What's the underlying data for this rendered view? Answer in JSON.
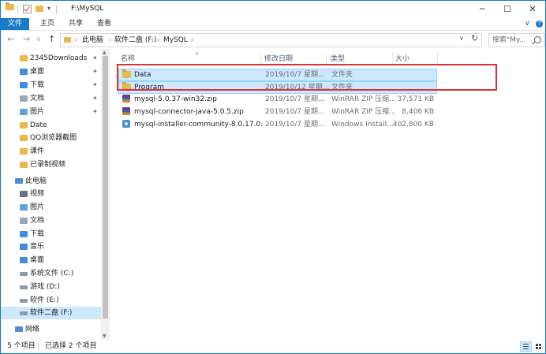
{
  "window": {
    "title": "F:\\MySQL",
    "controls": {
      "minimize": "─",
      "maximize": "☐",
      "close": "✕"
    }
  },
  "ribbon": {
    "tabs": [
      "文件",
      "主页",
      "共享",
      "查看"
    ],
    "expand_icon": "chevron-down-icon",
    "help_icon": "help-icon"
  },
  "nav": {
    "back": "←",
    "forward": "→",
    "recent": "∨",
    "up": "↑",
    "breadcrumb": [
      "此电脑",
      "软件二盘 (F:)",
      "MySQL"
    ],
    "search_placeholder": "搜索\"My...",
    "refresh": "↻",
    "dropdown": "∨"
  },
  "sidebar": {
    "items": [
      {
        "label": "2345Downloads",
        "icon": "folder-icon",
        "pinned": true
      },
      {
        "label": "桌面",
        "icon": "desktop-folder-icon",
        "pinned": true
      },
      {
        "label": "下载",
        "icon": "download-folder-icon",
        "pinned": true
      },
      {
        "label": "文档",
        "icon": "documents-folder-icon",
        "pinned": true
      },
      {
        "label": "图片",
        "icon": "pictures-folder-icon",
        "pinned": true
      },
      {
        "label": "Date",
        "icon": "folder-icon",
        "pinned": false
      },
      {
        "label": "QQ浏览器截图",
        "icon": "folder-icon",
        "pinned": false
      },
      {
        "label": "课件",
        "icon": "folder-icon",
        "pinned": false
      },
      {
        "label": "已录制视频",
        "icon": "folder-icon",
        "pinned": false
      },
      {
        "label": "此电脑",
        "icon": "computer-icon",
        "pinned": false
      },
      {
        "label": "视频",
        "icon": "videos-folder-icon",
        "pinned": false
      },
      {
        "label": "图片",
        "icon": "pictures-folder-icon",
        "pinned": false
      },
      {
        "label": "文档",
        "icon": "documents-folder-icon",
        "pinned": false
      },
      {
        "label": "下载",
        "icon": "download-folder-icon",
        "pinned": false
      },
      {
        "label": "音乐",
        "icon": "music-folder-icon",
        "pinned": false
      },
      {
        "label": "桌面",
        "icon": "desktop-folder-icon",
        "pinned": false
      },
      {
        "label": "系统文件 (C:)",
        "icon": "drive-icon",
        "pinned": false
      },
      {
        "label": "游戏 (D:)",
        "icon": "drive-icon",
        "pinned": false
      },
      {
        "label": "软件 (E:)",
        "icon": "drive-icon",
        "pinned": false
      },
      {
        "label": "软件二盘 (F:)",
        "icon": "drive-icon",
        "pinned": false,
        "selected": true
      },
      {
        "label": "网络",
        "icon": "network-icon",
        "pinned": false
      }
    ]
  },
  "columns": [
    "名称",
    "修改日期",
    "类型",
    "大小"
  ],
  "files": [
    {
      "name": "Data",
      "date": "2019/10/7 星期...",
      "type": "文件夹",
      "size": "",
      "icon": "folder-icon",
      "selected": true
    },
    {
      "name": "Program",
      "date": "2019/10/12 星期...",
      "type": "文件夹",
      "size": "",
      "icon": "folder-icon",
      "selected": true
    },
    {
      "name": "mysql-5.0.37-win32.zip",
      "date": "2019/10/7 星期...",
      "type": "WinRAR ZIP 压缩...",
      "size": "37,571 KB",
      "icon": "winrar-zip-icon",
      "selected": false
    },
    {
      "name": "mysql-connector-java-5.0.5.zip",
      "date": "2019/10/7 星期...",
      "type": "WinRAR ZIP 压缩...",
      "size": "8,406 KB",
      "icon": "winrar-zip-icon",
      "selected": false
    },
    {
      "name": "mysql-installer-community-8.0.17.0....",
      "date": "2019/10/7 星期...",
      "type": "Windows Install...",
      "size": "402,800 KB",
      "icon": "installer-icon",
      "selected": false
    }
  ],
  "status": {
    "item_count": "5 个项目",
    "selected_count": "已选择 2 个项目"
  },
  "colors": {
    "accent": "#1979ca",
    "selection": "#cce8ff",
    "annotation_border": "#e03030",
    "folder": "#e8b94c"
  }
}
